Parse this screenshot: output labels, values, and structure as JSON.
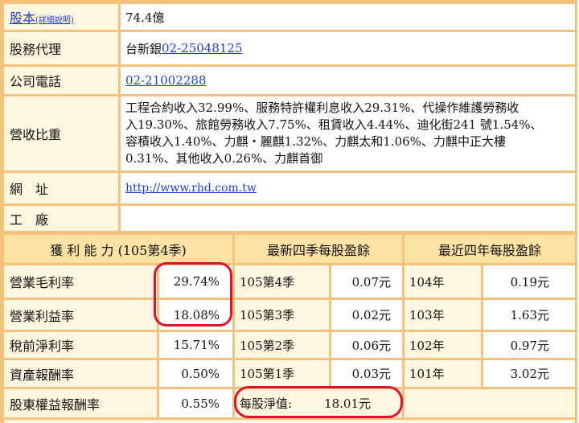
{
  "info": {
    "capital": {
      "label": "股本",
      "note": "(詳細說明)",
      "value": "74.4億"
    },
    "agent": {
      "label": "股務代理",
      "value_prefix": "台新銀",
      "phone": "02-25048125"
    },
    "phone": {
      "label": "公司電話",
      "value": "02-21002288"
    },
    "revenue": {
      "label": "營收比重",
      "lines": [
        "工程合約收入32.99%、服務特許權利息收入29.31%、代操作維護勞務收",
        "入19.30%、旅館勞務收入7.75%、租賃收入4.44%、迪化街241 號1.54%、",
        "容積收入1.40%、力麒‧麗麒1.32%、力麒太和1.06%、力麒中正大樓",
        "0.31%、其他收入0.26%、力麒首御"
      ]
    },
    "website": {
      "label": "網　址",
      "value": "http://www.rhd.com.tw"
    },
    "factory": {
      "label": "工　廠",
      "value": ""
    }
  },
  "profit": {
    "header": "獲 利 能 力 (105第4季)",
    "rows": [
      {
        "label": "營業毛利率",
        "value": "29.74%"
      },
      {
        "label": "營業利益率",
        "value": "18.08%"
      },
      {
        "label": "稅前淨利率",
        "value": "15.71%"
      },
      {
        "label": "資產報酬率",
        "value": "0.50%"
      },
      {
        "label": "股東權益報酬率",
        "value": "0.55%"
      }
    ]
  },
  "eps_quarters": {
    "header": "最新四季每股盈餘",
    "rows": [
      {
        "label": "105第4季",
        "value": "0.07元"
      },
      {
        "label": "105第3季",
        "value": "0.02元"
      },
      {
        "label": "105第2季",
        "value": "0.06元"
      },
      {
        "label": "105第1季",
        "value": "0.03元"
      }
    ]
  },
  "eps_years": {
    "header": "最近四年每股盈餘",
    "rows": [
      {
        "label": "104年",
        "value": "0.19元"
      },
      {
        "label": "103年",
        "value": "1.63元"
      },
      {
        "label": "102年",
        "value": "0.97元"
      },
      {
        "label": "101年",
        "value": "3.02元"
      }
    ]
  },
  "nav": {
    "label": "每股淨值:",
    "value": "18.01元"
  },
  "colors": {
    "border": "#f3c37d",
    "label_bg": "#fff6df",
    "header_bg": "#fce2a3",
    "link": "#1a3fd6",
    "annotation": "#e3102c"
  }
}
